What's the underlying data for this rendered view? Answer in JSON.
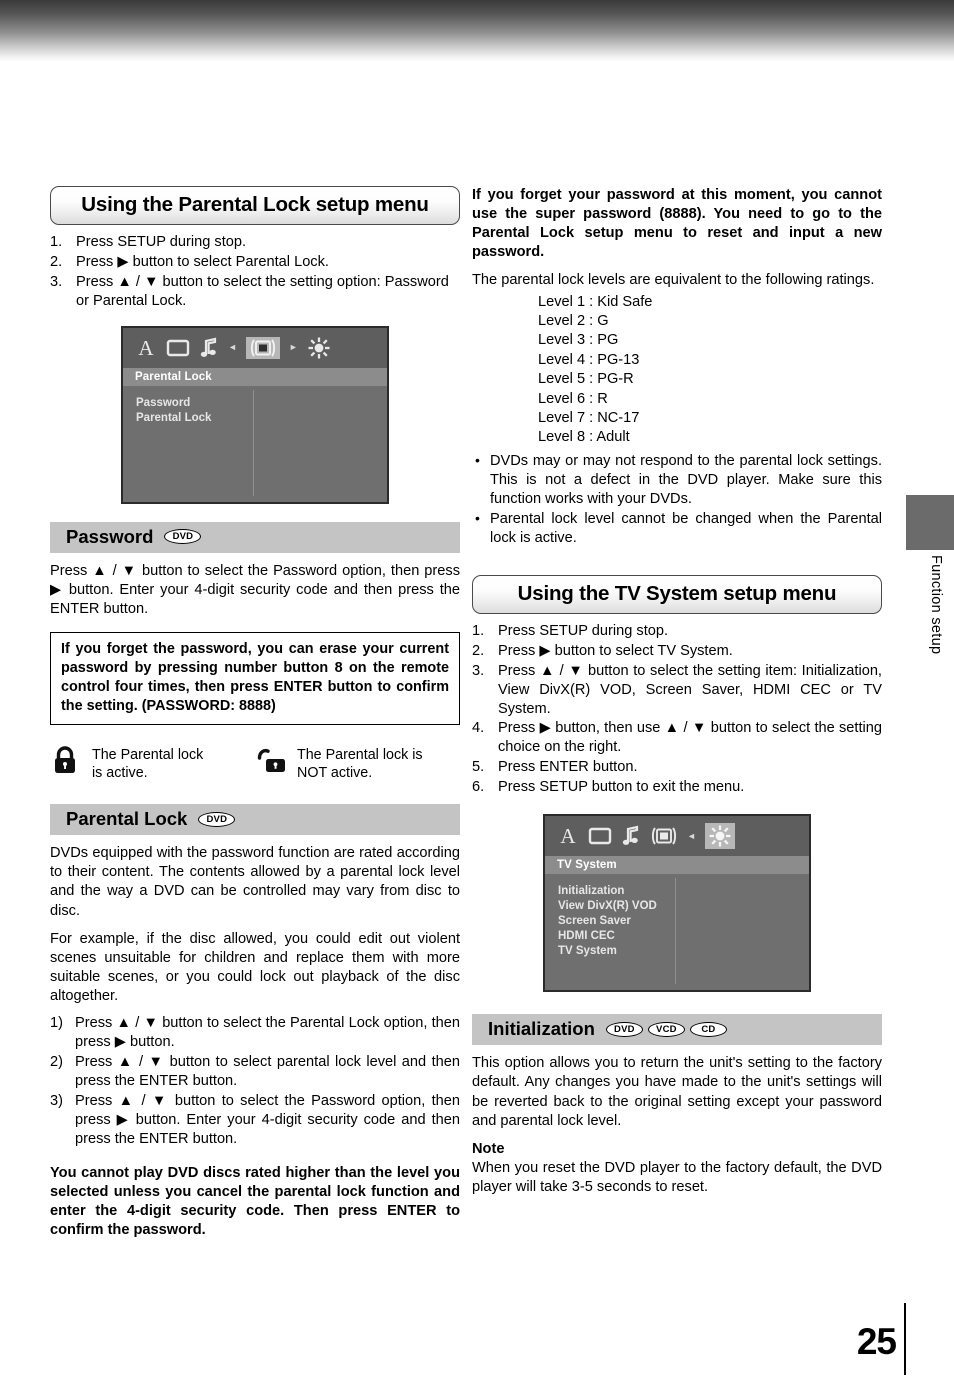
{
  "page": {
    "number": "25",
    "side_tab": "Function setup"
  },
  "left": {
    "heading": "Using the Parental Lock setup menu",
    "steps": [
      {
        "n": "1.",
        "text": "Press SETUP during stop."
      },
      {
        "n": "2.",
        "text": "Press ▶ button to select Parental Lock."
      },
      {
        "n": "3.",
        "text": "Press ▲ / ▼ button to select the setting option: Password or Parental Lock."
      }
    ],
    "osd": {
      "title": "Parental Lock",
      "items": [
        "Password",
        "Parental Lock"
      ],
      "icons": [
        "text-icon",
        "tv-icon",
        "music-note-icon",
        "display-icon",
        "sun-icon"
      ],
      "highlighted_icon": "display-icon"
    },
    "password_section": {
      "title": "Password",
      "badges": [
        "DVD"
      ],
      "body": "Press ▲ / ▼ button to select the Password option, then press ▶ button. Enter your 4-digit security code and then press the ENTER button.",
      "warning": "If you forget the password, you can erase your current password by pressing number button 8 on the remote control four times, then press ENTER button to confirm the setting. (PASSWORD: 8888)",
      "legend": [
        {
          "icon": "lock-closed-icon",
          "line1": "The Parental lock",
          "line2": "is active."
        },
        {
          "icon": "lock-open-icon",
          "line1": "The Parental lock is",
          "line2": "NOT active."
        }
      ]
    },
    "parental_section": {
      "title": "Parental Lock",
      "badges": [
        "DVD"
      ],
      "para1": "DVDs equipped with the password function are rated according to their content. The contents allowed by a parental lock level and the way a DVD can be controlled may vary from disc to disc.",
      "para2": "For example, if the disc allowed, you could edit out violent scenes unsuitable for children and replace them with more suitable scenes, or you could lock out playback of the disc altogether.",
      "steps": [
        {
          "n": "1)",
          "text": "Press ▲ / ▼ button to select the Parental Lock option, then press ▶ button."
        },
        {
          "n": "2)",
          "text": "Press ▲ / ▼ button to select parental lock level and then press the ENTER button."
        },
        {
          "n": "3)",
          "text": "Press ▲ / ▼ button to select the Password option, then press ▶ button. Enter your 4-digit security code and then press the ENTER button."
        }
      ],
      "footer_bold": "You cannot play DVD discs rated higher than the level you selected unless you cancel the parental lock function and enter the 4-digit security code. Then press ENTER to confirm the password."
    }
  },
  "right": {
    "warning_bold": "If you forget your password at this moment, you cannot use the super password (8888). You need to go to the Parental Lock setup menu to reset and input a new password.",
    "ratings_intro": "The parental lock levels are equivalent to the following ratings.",
    "levels": [
      "Level 1 : Kid Safe",
      "Level 2 : G",
      "Level 3 : PG",
      "Level 4 : PG-13",
      "Level 5 : PG-R",
      "Level 6 : R",
      "Level 7 : NC-17",
      "Level 8 : Adult"
    ],
    "bullets": [
      "DVDs may or may not respond to the parental lock settings. This is not a defect in the DVD player. Make sure this function works with your DVDs.",
      "Parental lock level cannot be changed when the Parental lock is active."
    ],
    "heading": "Using the TV System setup menu",
    "steps": [
      {
        "n": "1.",
        "text": "Press SETUP during stop."
      },
      {
        "n": "2.",
        "text": "Press ▶ button to select TV System."
      },
      {
        "n": "3.",
        "text": "Press ▲ / ▼ button to select the setting item: Initialization, View DivX(R) VOD, Screen Saver, HDMI CEC or TV System."
      },
      {
        "n": "4.",
        "text": "Press ▶ button, then use ▲ / ▼ button to select the setting choice on the right."
      },
      {
        "n": "5.",
        "text": "Press ENTER button."
      },
      {
        "n": "6.",
        "text": "Press SETUP button to exit the menu."
      }
    ],
    "osd": {
      "title": "TV System",
      "items": [
        "Initialization",
        "View DivX(R) VOD",
        "Screen Saver",
        "HDMI CEC",
        "TV System"
      ],
      "icons": [
        "text-icon",
        "tv-icon",
        "music-note-icon",
        "display-icon",
        "sun-icon"
      ],
      "highlighted_icon": "sun-icon"
    },
    "init_section": {
      "title": "Initialization",
      "badges": [
        "DVD",
        "VCD",
        "CD"
      ],
      "body": "This option allows you to return the unit's setting to the factory default. Any changes you have made to the unit's settings will be reverted back to the original setting except your password and parental lock level.",
      "note_label": "Note",
      "note_body": "When you reset the DVD player to the factory default, the DVD player will take 3-5 seconds to reset."
    }
  }
}
